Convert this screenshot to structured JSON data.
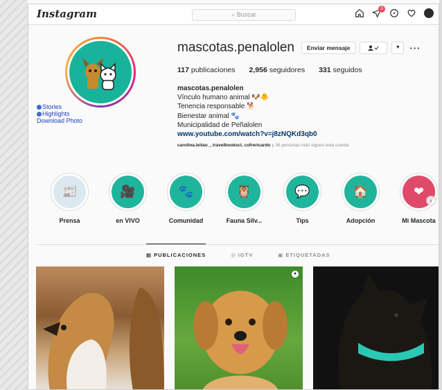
{
  "header": {
    "logo": "Instagram",
    "search_placeholder": "Buscar",
    "notification_count": "3"
  },
  "side_links": {
    "stories": "Stories",
    "highlights": "Highlights",
    "download": "Download Photo"
  },
  "profile": {
    "username": "mascotas.penalolen",
    "message_button": "Enviar mensaje",
    "publications_count": "117",
    "publications_label": "publicaciones",
    "followers_count": "2,956",
    "followers_label": "seguidores",
    "following_count": "331",
    "following_label": "seguidos",
    "bio_name": "mascotas.penalolen",
    "bio_lines": [
      "Vínculo humano animal 🐶🐥",
      "Tenencia responsable 🐕",
      "Bienestar animal 🐾",
      "Municipalidad de Peñalolen"
    ],
    "bio_link": "www.youtube.com/watch?v=j8zNQKd3qb0",
    "followed_by_names": "carolina.leitao_, travelbookscl, cofrericardo",
    "followed_by_rest": "y 36 personas más siguen esta cuenta"
  },
  "highlights": [
    {
      "label": "Prensa",
      "emoji": "📰"
    },
    {
      "label": "en VIVO",
      "emoji": "🎥"
    },
    {
      "label": "Comunidad",
      "emoji": "🐾"
    },
    {
      "label": "Fauna Silv...",
      "emoji": "🦉"
    },
    {
      "label": "Tips",
      "emoji": "💬"
    },
    {
      "label": "Adopción",
      "emoji": "🏠"
    },
    {
      "label": "Mi Mascota",
      "emoji": "❤"
    }
  ],
  "tabs": [
    {
      "label": "PUBLICACIONES",
      "icon": "grid-icon",
      "active": true
    },
    {
      "label": "IGTV",
      "icon": "igtv-icon",
      "active": false
    },
    {
      "label": "ETIQUETADAS",
      "icon": "tagged-icon",
      "active": false
    }
  ],
  "posts": [
    {
      "subject": "collie-dogs"
    },
    {
      "subject": "golden-retriever",
      "badge": "video-icon"
    },
    {
      "subject": "black-cat"
    }
  ]
}
